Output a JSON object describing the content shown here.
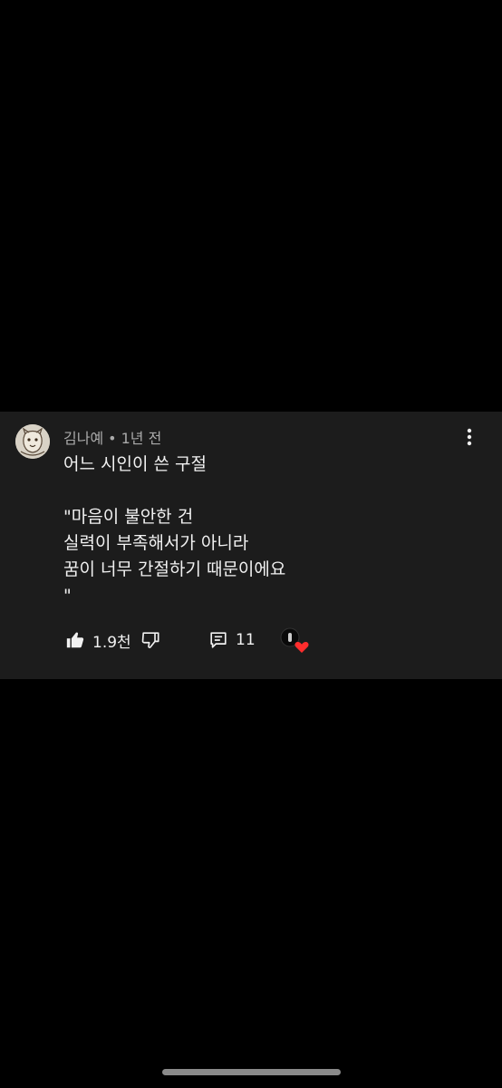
{
  "comment": {
    "author": "김나예",
    "separator": "•",
    "time": "1년 전",
    "lines": [
      "어느 시인이 쓴 구절",
      "",
      "\"마음이 불안한 건",
      "실력이 부족해서가 아니라",
      "꿈이 너무 간절하기 때문이에요",
      "\""
    ]
  },
  "actions": {
    "like_count": "1.9천",
    "reply_count": "11"
  },
  "icons": {
    "avatar": "avatar-sketch",
    "more": "kebab-icon",
    "like": "thumbs-up-icon",
    "dislike": "thumbs-down-icon",
    "reply": "comment-icon",
    "creator_heart": "heart-icon"
  },
  "colors": {
    "background": "#000000",
    "card": "#1c1c1c",
    "text": "#f1f1f1",
    "muted": "#aaaaaa",
    "heart": "#ff2d2d"
  }
}
